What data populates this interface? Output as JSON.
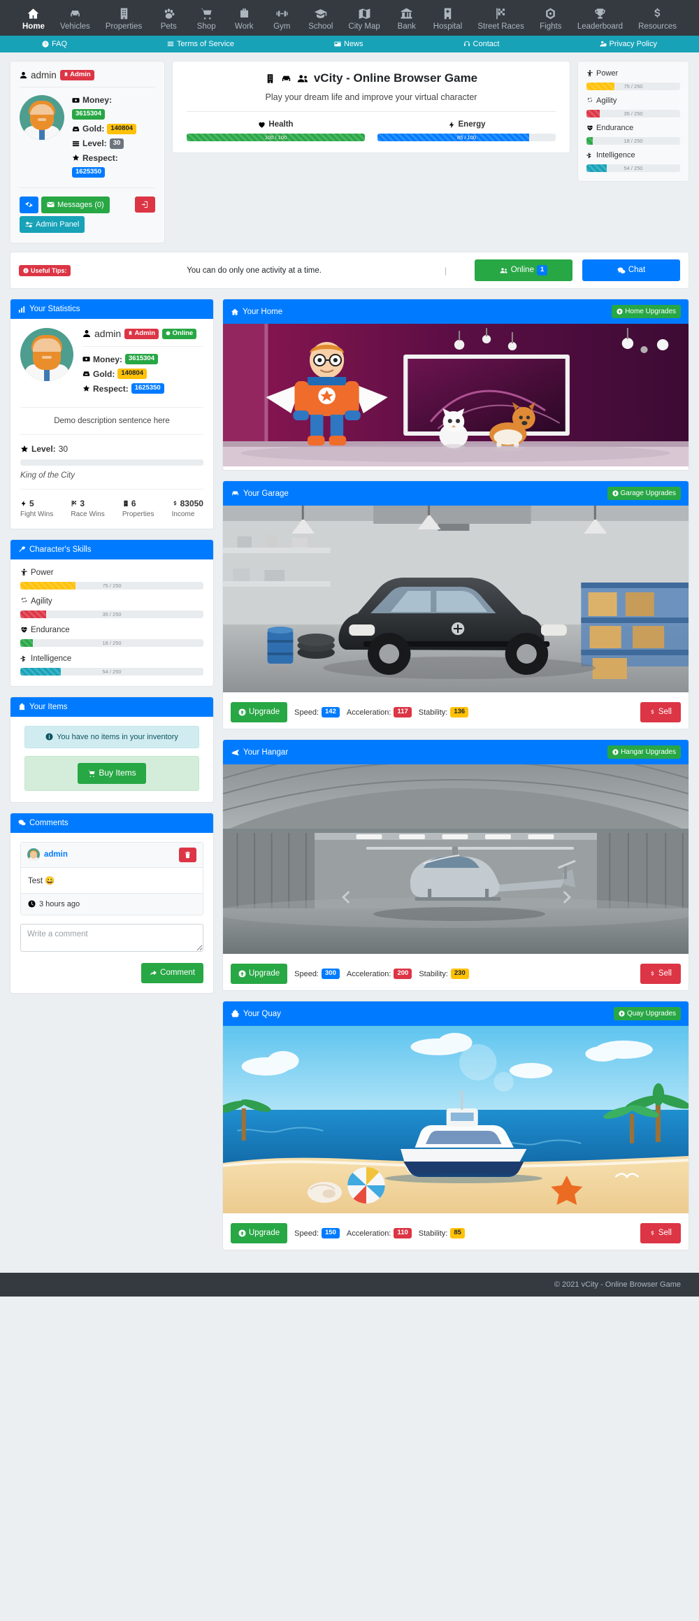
{
  "nav": {
    "items": [
      {
        "label": "Home",
        "icon": "home-icon",
        "active": true
      },
      {
        "label": "Vehicles",
        "icon": "car-icon",
        "active": false
      },
      {
        "label": "Properties",
        "icon": "building-icon",
        "active": false
      },
      {
        "label": "Pets",
        "icon": "paw-icon",
        "active": false
      },
      {
        "label": "Shop",
        "icon": "cart-icon",
        "active": false
      },
      {
        "label": "Work",
        "icon": "briefcase-icon",
        "active": false
      },
      {
        "label": "Gym",
        "icon": "dumbbell-icon",
        "active": false
      },
      {
        "label": "School",
        "icon": "graduation-cap-icon",
        "active": false
      },
      {
        "label": "City Map",
        "icon": "map-icon",
        "active": false
      },
      {
        "label": "Bank",
        "icon": "bank-icon",
        "active": false
      },
      {
        "label": "Hospital",
        "icon": "hospital-icon",
        "active": false
      },
      {
        "label": "Street Races",
        "icon": "checkered-flag-icon",
        "active": false
      },
      {
        "label": "Fights",
        "icon": "fist-icon",
        "active": false
      },
      {
        "label": "Leaderboard",
        "icon": "trophy-icon",
        "active": false
      },
      {
        "label": "Resources",
        "icon": "dollar-icon",
        "active": false
      }
    ]
  },
  "subnav": {
    "items": [
      {
        "label": "FAQ",
        "icon": "question-circle-icon"
      },
      {
        "label": "Terms of Service",
        "icon": "list-icon"
      },
      {
        "label": "News",
        "icon": "newspaper-icon"
      },
      {
        "label": "Contact",
        "icon": "headset-icon"
      },
      {
        "label": "Privacy Policy",
        "icon": "user-shield-icon"
      }
    ]
  },
  "user_card": {
    "username": "admin",
    "admin_badge": "Admin",
    "money_label": "Money:",
    "money_value": "3615304",
    "gold_label": "Gold:",
    "gold_value": "140804",
    "level_label": "Level:",
    "level_value": "30",
    "respect_label": "Respect:",
    "respect_value": "1625350",
    "settings_icon": "gear-icon",
    "messages_label": "Messages (0)",
    "admin_panel_label": "Admin Panel",
    "logout_icon": "logout-icon"
  },
  "header": {
    "title": "vCity - Online Browser Game",
    "subtitle": "Play your dream life and improve your virtual character",
    "health_label": "Health",
    "health_text": "100 / 100",
    "health_pct": 100,
    "energy_label": "Energy",
    "energy_text": "85 / 100",
    "energy_pct": 85
  },
  "skills": [
    {
      "name": "Power",
      "icon": "power-icon",
      "text": "75 / 250",
      "pct": 30,
      "color": "#ffc107"
    },
    {
      "name": "Agility",
      "icon": "agility-icon",
      "text": "35 / 250",
      "pct": 14,
      "color": "#dc3545"
    },
    {
      "name": "Endurance",
      "icon": "heartbeat-icon",
      "text": "18 / 250",
      "pct": 7,
      "color": "#28a745"
    },
    {
      "name": "Intelligence",
      "icon": "brain-icon",
      "text": "54 / 250",
      "pct": 22,
      "color": "#17a2b8"
    }
  ],
  "tips": {
    "badge": "Useful Tips:",
    "text": "You can do only one activity at a time.",
    "separator": "|",
    "online_label": "Online",
    "online_count": "1",
    "chat_label": "Chat"
  },
  "statistics": {
    "panel_title": "Your Statistics",
    "panel_icon": "chart-bar-icon",
    "username": "admin",
    "admin_badge": "Admin",
    "online_badge": "Online",
    "money_label": "Money:",
    "money_value": "3615304",
    "gold_label": "Gold:",
    "gold_value": "140804",
    "respect_label": "Respect:",
    "respect_value": "1625350",
    "description": "Demo description sentence here",
    "level_label": "Level:",
    "level_value": "30",
    "rank": "King of the City",
    "cells": [
      {
        "value": "5",
        "caption": "Fight Wins",
        "icon": "bolt-icon"
      },
      {
        "value": "3",
        "caption": "Race Wins",
        "icon": "flag-icon"
      },
      {
        "value": "6",
        "caption": "Properties",
        "icon": "building-icon"
      },
      {
        "value": "83050",
        "caption": "Income",
        "icon": "dollar-icon"
      }
    ]
  },
  "skills_panel": {
    "panel_title": "Character's Skills",
    "panel_icon": "wrench-icon"
  },
  "items_panel": {
    "panel_title": "Your Items",
    "panel_icon": "bag-icon",
    "empty_text": "You have no items in your inventory",
    "buy_label": "Buy Items"
  },
  "comments_panel": {
    "panel_title": "Comments",
    "panel_icon": "comments-icon",
    "comment": {
      "author": "admin",
      "text": "Test 😀",
      "time": "3 hours ago",
      "delete_icon": "trash-icon"
    },
    "input_placeholder": "Write a comment",
    "submit_label": "Comment"
  },
  "properties": [
    {
      "title": "Your Home",
      "icon": "home-icon",
      "upgrade_button": "Home Upgrades",
      "image": "home-interior",
      "has_actions": false
    },
    {
      "title": "Your Garage",
      "icon": "car-icon",
      "upgrade_button": "Garage Upgrades",
      "image": "garage-suv",
      "has_actions": true,
      "upgrade_label": "Upgrade",
      "speed_label": "Speed:",
      "speed_value": "142",
      "accel_label": "Acceleration:",
      "accel_value": "117",
      "stability_label": "Stability:",
      "stability_value": "136",
      "sell_label": "Sell"
    },
    {
      "title": "Your Hangar",
      "icon": "plane-icon",
      "upgrade_button": "Hangar Upgrades",
      "image": "hangar-helicopter",
      "has_actions": true,
      "upgrade_label": "Upgrade",
      "speed_label": "Speed:",
      "speed_value": "300",
      "accel_label": "Acceleration:",
      "accel_value": "200",
      "stability_label": "Stability:",
      "stability_value": "230",
      "sell_label": "Sell"
    },
    {
      "title": "Your Quay",
      "icon": "ship-icon",
      "upgrade_button": "Quay Upgrades",
      "image": "quay-boat",
      "has_actions": true,
      "upgrade_label": "Upgrade",
      "speed_label": "Speed:",
      "speed_value": "150",
      "accel_label": "Acceleration:",
      "accel_value": "110",
      "stability_label": "Stability:",
      "stability_value": "85",
      "sell_label": "Sell"
    }
  ],
  "footer": {
    "text": "© 2021 vCity - Online Browser Game"
  },
  "colors": {
    "primary": "#007bff",
    "success": "#28a745",
    "danger": "#dc3545",
    "warning": "#ffc107",
    "info": "#17a2b8",
    "dark": "#343a40"
  }
}
